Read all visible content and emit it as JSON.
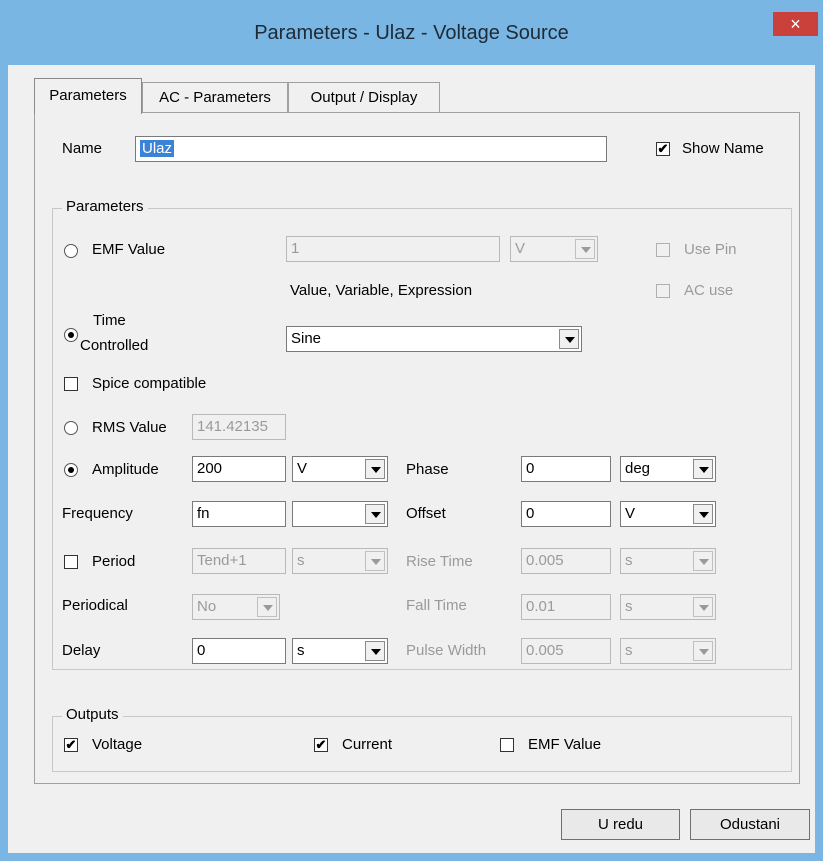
{
  "window": {
    "title": "Parameters - Ulaz - Voltage Source",
    "close_glyph": "×"
  },
  "tabs": [
    {
      "label": "Parameters",
      "active": true
    },
    {
      "label": "AC - Parameters",
      "active": false
    },
    {
      "label": "Output / Display",
      "active": false
    }
  ],
  "name_row": {
    "label": "Name",
    "value": "Ulaz",
    "show_name_label": "Show Name",
    "show_name_checked": true
  },
  "parameters_group": {
    "legend": "Parameters",
    "emf": {
      "label": "EMF Value",
      "value": "1",
      "unit": "V",
      "hint": "Value, Variable, Expression",
      "use_pin_label": "Use Pin",
      "ac_use_label": "AC use"
    },
    "time_controlled": {
      "label_line1": "Time",
      "label_line2": "Controlled",
      "selected": true,
      "value": "Sine"
    },
    "spice": {
      "label": "Spice compatible",
      "checked": false
    },
    "rms": {
      "label": "RMS Value",
      "value": "141.42135"
    },
    "amplitude": {
      "label": "Amplitude",
      "value": "200",
      "unit": "V",
      "selected": true
    },
    "phase": {
      "label": "Phase",
      "value": "0",
      "unit": "deg"
    },
    "frequency": {
      "label": "Frequency",
      "value": "fn",
      "unit": ""
    },
    "offset": {
      "label": "Offset",
      "value": "0",
      "unit": "V"
    },
    "period": {
      "label": "Period",
      "value": "Tend+1",
      "unit": "s"
    },
    "rise_time": {
      "label": "Rise Time",
      "value": "0.005",
      "unit": "s"
    },
    "periodical": {
      "label": "Periodical",
      "value": "No"
    },
    "fall_time": {
      "label": "Fall Time",
      "value": "0.01",
      "unit": "s"
    },
    "delay": {
      "label": "Delay",
      "value": "0",
      "unit": "s"
    },
    "pulse_width": {
      "label": "Pulse Width",
      "value": "0.005",
      "unit": "s"
    }
  },
  "outputs_group": {
    "legend": "Outputs",
    "voltage": {
      "label": "Voltage",
      "checked": true
    },
    "current": {
      "label": "Current",
      "checked": true
    },
    "emf_value": {
      "label": "EMF Value",
      "checked": false
    }
  },
  "buttons": {
    "ok": "U redu",
    "cancel": "Odustani"
  },
  "colors": {
    "frame": "#79b6e3",
    "close": "#c9413a",
    "selection": "#3b83d6"
  },
  "check_glyph": "✔"
}
